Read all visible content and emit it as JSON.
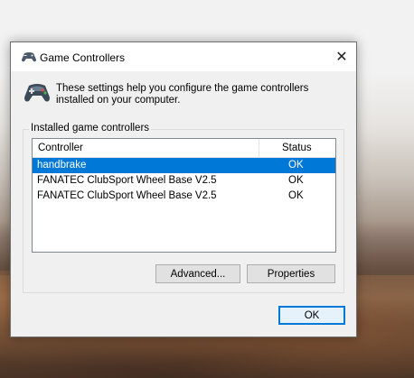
{
  "window": {
    "title": "Game Controllers",
    "close_glyph": "✕",
    "description": "These settings help you configure the game controllers installed on your computer."
  },
  "group": {
    "label": "Installed game controllers",
    "columns": [
      "Controller",
      "Status"
    ],
    "rows": [
      {
        "controller": "handbrake",
        "status": "OK",
        "selected": true
      },
      {
        "controller": "FANATEC ClubSport Wheel Base V2.5",
        "status": "OK",
        "selected": false
      },
      {
        "controller": "FANATEC ClubSport Wheel Base V2.5",
        "status": "OK",
        "selected": false
      }
    ]
  },
  "buttons": {
    "advanced": "Advanced...",
    "properties": "Properties",
    "ok": "OK"
  },
  "colors": {
    "selection": "#0078d7",
    "dialog_bg": "#f0f0f0"
  },
  "icons": {
    "title": "gamepad-icon",
    "header": "gamepad-icon",
    "close": "close-icon"
  }
}
